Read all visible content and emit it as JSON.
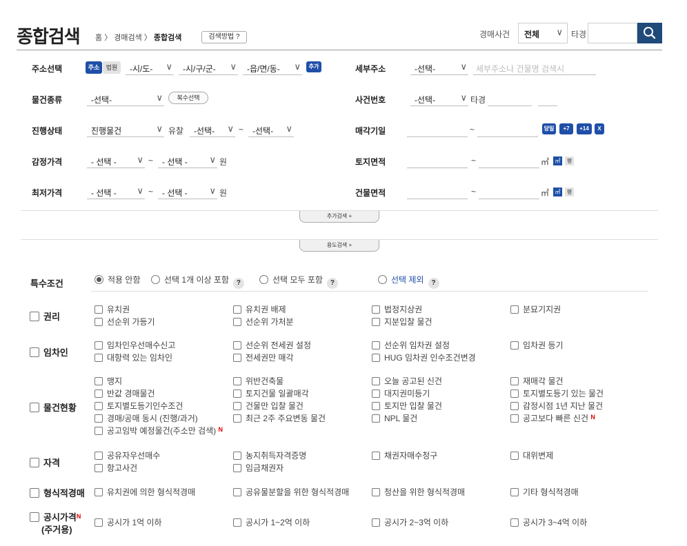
{
  "header": {
    "title": "종합검색",
    "crumb_home": "홈",
    "crumb_sep": "〉",
    "crumb_1": "경매검색",
    "crumb_2": "종합검색",
    "how_btn": "검색방법 ?",
    "case_label": "경매사건",
    "case_select": "전체",
    "tagyeong": "타경"
  },
  "rows": {
    "address": {
      "label": "주소선택",
      "tab_addr": "주소",
      "tab_court": "법원",
      "sido": "-시/도-",
      "sigungu": "-시/구/군-",
      "eupmyeon": "-읍/면/동-",
      "add": "추가"
    },
    "detail": {
      "label": "세부주소",
      "select": "-선택-",
      "placeholder": "세부주소나 건물명 검색시"
    },
    "type": {
      "label": "물건종류",
      "select": "-선택-",
      "multi": "복수선택"
    },
    "case_no": {
      "label": "사건번호",
      "select": "-선택-",
      "tagyeong": "타경"
    },
    "status": {
      "label": "진행상태",
      "select": "진행물건",
      "fail_label": "유찰",
      "fail_from": "-선택-",
      "tilde": "~",
      "fail_to": "-선택-"
    },
    "sale_date": {
      "label": "매각기일",
      "tilde": "~",
      "b1": "당일",
      "b2": "+7",
      "b3": "+14",
      "b4": "X"
    },
    "appraisal": {
      "label": "감정가격",
      "from": "- 선택 -",
      "tilde": "~",
      "to": "- 선택 -",
      "unit": "원"
    },
    "land_area": {
      "label": "토지면적",
      "tilde": "~",
      "unit": "㎡",
      "u1": "㎡",
      "u2": "평"
    },
    "min_price": {
      "label": "최저가격",
      "from": "- 선택 -",
      "tilde": "~",
      "to": "- 선택 -",
      "unit": "원"
    },
    "bldg_area": {
      "label": "건물면적",
      "tilde": "~",
      "unit": "㎡",
      "u1": "㎡",
      "u2": "평"
    }
  },
  "extra_btn": "추가검색 +",
  "use_btn": "용도검색 +",
  "special": {
    "label": "특수조건",
    "opt1": "적용 안함",
    "opt2": "선택 1개 이상 포함",
    "opt3": "선택 모두 포함",
    "opt4": "선택 제외",
    "q": "?"
  },
  "categories": {
    "rights": {
      "label": "권리",
      "items": [
        "유치권",
        "유치권 배제",
        "법정지상권",
        "분묘기지권",
        "선순위 가등기",
        "선순위 가처분",
        "지분입찰 물건"
      ]
    },
    "tenant": {
      "label": "임차인",
      "items": [
        "임차인우선매수신고",
        "선순위 전세권 설정",
        "선순위 임차권 설정",
        "임차권 등기",
        "대항력 있는 임차인",
        "전세권만 매각",
        "HUG 임차권 인수조건변경"
      ]
    },
    "status": {
      "label": "물건현황",
      "items": [
        "맹지",
        "위반건축물",
        "오늘 공고된 신건",
        "재매각 물건",
        "반값 경매물건",
        "토지건물 일괄매각",
        "대지권미등기",
        "토지별도등기 있는 물건",
        "토지별도등기인수조건",
        "건물만 입찰 물건",
        "토지만 입찰 물건",
        "감정시점 1년 지난 물건",
        "경매/공매 동시 (진행/과거)",
        "최근 2주 주요변동 물건",
        "NPL 물건",
        "공고보다 빠른 신건",
        "공고임박 예정물건(주소만 검색)"
      ],
      "new_mark": "N"
    },
    "qual": {
      "label": "자격",
      "items": [
        "공유자우선매수",
        "농지취득자격증명",
        "채권자매수청구",
        "대위변제",
        "항고사건",
        "임금채권자"
      ]
    },
    "formal": {
      "label": "형식적경매",
      "items": [
        "유치권에 의한 형식적경매",
        "공유물분할을 위한 형식적경매",
        "청산을 위한 형식적경매",
        "기타 형식적경매"
      ]
    },
    "public": {
      "label": "공시가격",
      "label2": "(주거용)",
      "new_mark": "N",
      "items": [
        "공시가 1억 이하",
        "공시가 1~2억 이하",
        "공시가 2~3억 이하",
        "공시가 3~4억 이하"
      ]
    }
  },
  "colors": {
    "accent": "#1f4fa8",
    "search_btn": "#1f4a7a",
    "new_mark": "#e00000"
  }
}
